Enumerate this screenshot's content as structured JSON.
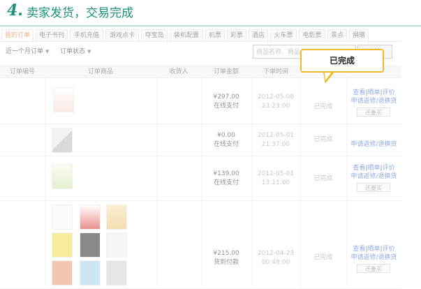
{
  "step": {
    "number": "4.",
    "title": "卖家发货，交易完成"
  },
  "tabs": [
    "我的订单",
    "电子书刊",
    "手机充值",
    "游戏点卡",
    "夺宝岛",
    "装机配置",
    "机票",
    "彩票",
    "酒店",
    "火车票",
    "电影票",
    "景点",
    "捐赠"
  ],
  "filters": {
    "time_range": "近一个月订单",
    "order_status": "订单状态",
    "search_placeholder": "商品名称、商品",
    "search_button": "查询"
  },
  "columns": [
    "订单编号",
    "订单商品",
    "收货人",
    "订单金额",
    "下单时间"
  ],
  "orders": [
    {
      "amount": "¥297.00",
      "payment": "在线支付",
      "date": "2012-05-08",
      "time": "23:23:00",
      "status": "已完成",
      "actions": [
        "查看",
        "晒单",
        "评价"
      ],
      "service": "申请返修/退换货",
      "rebuy": "还要买"
    },
    {
      "amount": "¥0.00",
      "payment": "在线支付",
      "date": "2012-05-01",
      "time": "21:37:00",
      "status": "已完成",
      "actions": [],
      "service": "申请返修/退换货",
      "rebuy": ""
    },
    {
      "amount": "¥139.00",
      "payment": "在线支付",
      "date": "2012-05-01",
      "time": "13:11:00",
      "status": "已完成",
      "actions": [
        "查看",
        "晒单",
        "评价"
      ],
      "service": "申请返修/退换货",
      "rebuy": "还要买"
    },
    {
      "amount": "¥215.00",
      "payment": "货到付款",
      "date": "2012-04-23",
      "time": "00:48:00",
      "status": "已完成",
      "actions": [
        "查看",
        "晒单",
        "评价"
      ],
      "service": "申请返修/退换货",
      "rebuy": "还要买"
    }
  ],
  "callout": "已完成",
  "colors": {
    "accent": "#1b8f7a",
    "callout_border": "#f0b92a",
    "link": "#3366cc",
    "active_tab": "#e86a1b"
  }
}
